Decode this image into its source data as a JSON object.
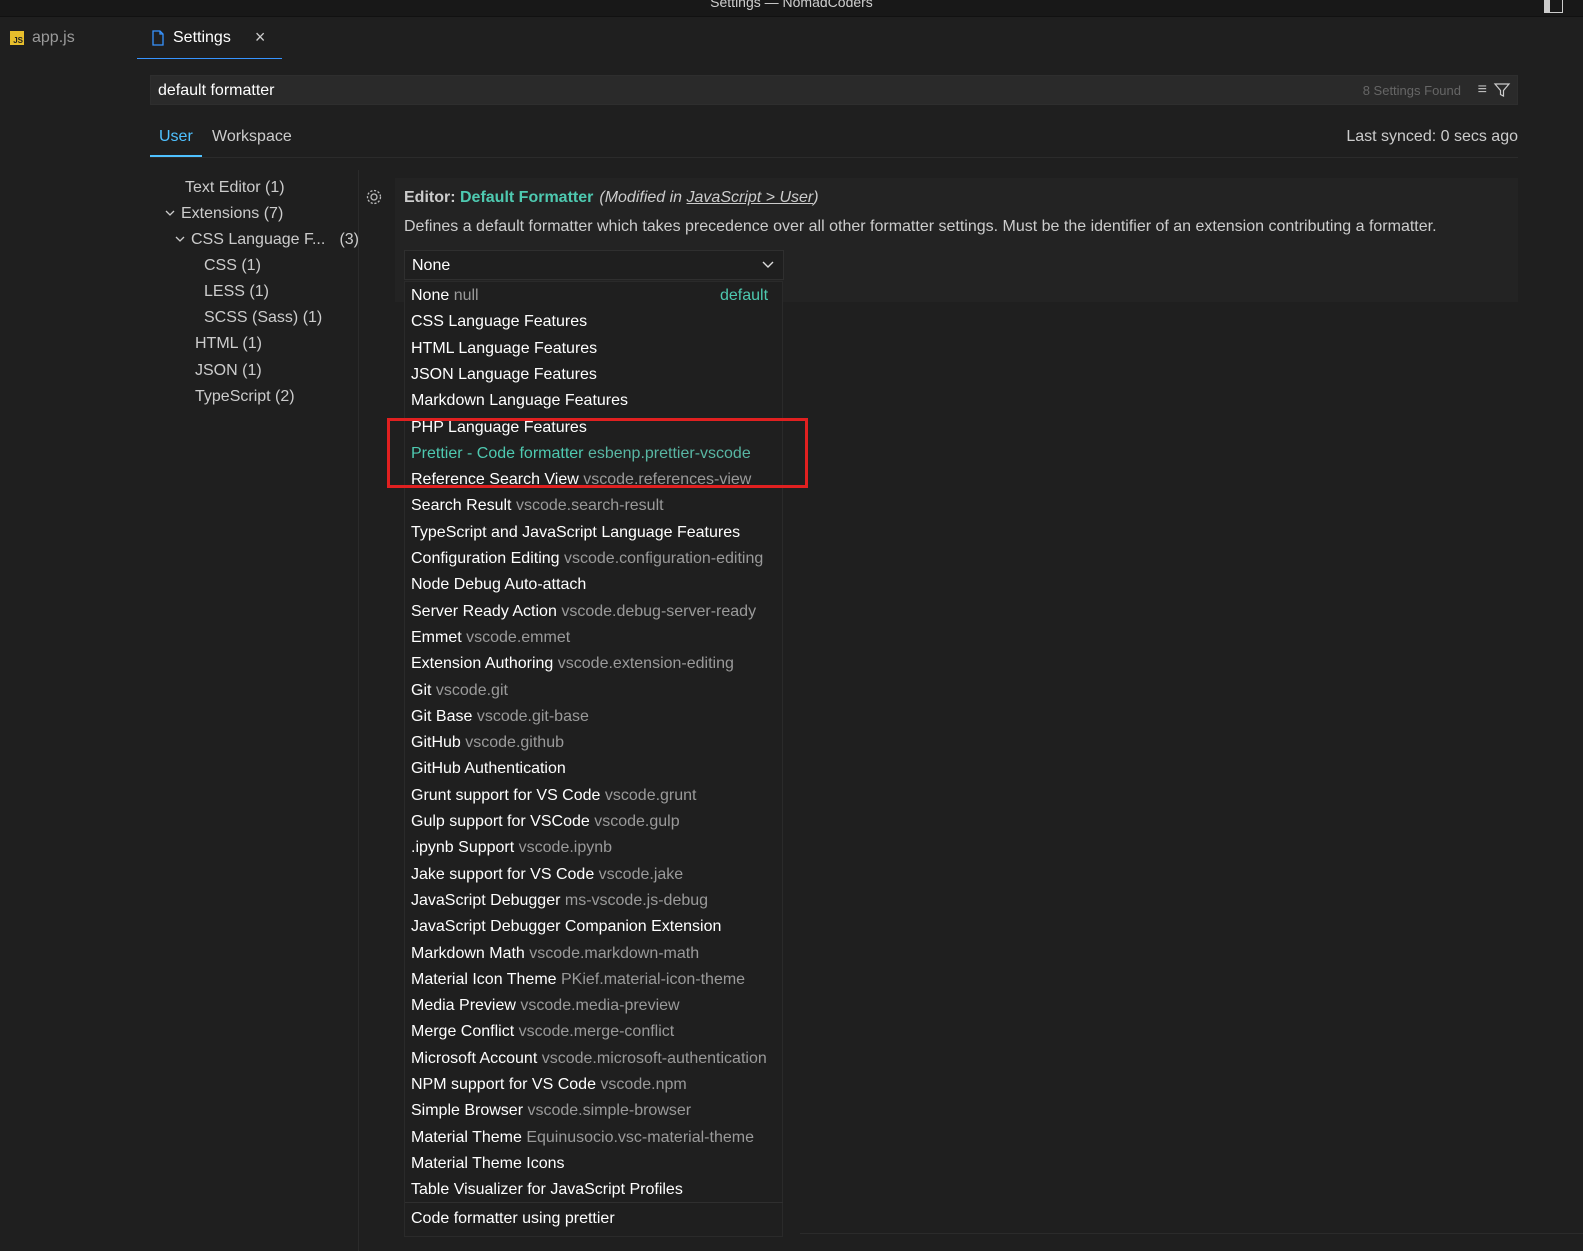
{
  "window": {
    "title": "Settings — NomadCoders"
  },
  "tabs": {
    "app": {
      "icon": "javascript-file-icon",
      "label": "app.js"
    },
    "settings": {
      "icon": "file-icon",
      "label": "Settings",
      "close": "×"
    }
  },
  "search": {
    "query": "default formatter",
    "results_found": "8 Settings Found",
    "clear_icon": "clear-filter-icon",
    "filter_icon": "filter-icon"
  },
  "scope": {
    "user": "User",
    "workspace": "Workspace",
    "last_synced": "Last synced: 0 secs ago"
  },
  "toc": [
    {
      "label": "Text Editor (1)"
    },
    {
      "label": "Extensions (7)",
      "expanded": true
    },
    {
      "label": "CSS Language F...",
      "count": "(3)",
      "expanded": true
    },
    {
      "label": "CSS (1)"
    },
    {
      "label": "LESS (1)"
    },
    {
      "label": "SCSS (Sass) (1)"
    },
    {
      "label": "HTML (1)"
    },
    {
      "label": "JSON (1)"
    },
    {
      "label": "TypeScript (2)"
    }
  ],
  "setting": {
    "category": "Editor: ",
    "name": "Default Formatter",
    "modified_prefix": "(Modified in ",
    "modified_link": "JavaScript > User",
    "modified_suffix": ")",
    "description": "Defines a default formatter which takes precedence over all other formatter settings. Must be the identifier of an extension contributing a formatter.",
    "selected_value": "None"
  },
  "dropdown": {
    "options": [
      {
        "label": "None",
        "id": "null",
        "badge": "default"
      },
      {
        "label": "CSS Language Features",
        "id": ""
      },
      {
        "label": "HTML Language Features",
        "id": ""
      },
      {
        "label": "JSON Language Features",
        "id": ""
      },
      {
        "label": "Markdown Language Features",
        "id": ""
      },
      {
        "label": "PHP Language Features",
        "id": ""
      },
      {
        "label": "Prettier - Code formatter",
        "id": "esbenp.prettier-vscode",
        "focused": true
      },
      {
        "label": "Reference Search View",
        "id": "vscode.references-view"
      },
      {
        "label": "Search Result",
        "id": "vscode.search-result"
      },
      {
        "label": "TypeScript and JavaScript Language Features",
        "id": ""
      },
      {
        "label": "Configuration Editing",
        "id": "vscode.configuration-editing"
      },
      {
        "label": "Node Debug Auto-attach",
        "id": ""
      },
      {
        "label": "Server Ready Action",
        "id": "vscode.debug-server-ready"
      },
      {
        "label": "Emmet",
        "id": "vscode.emmet"
      },
      {
        "label": "Extension Authoring",
        "id": "vscode.extension-editing"
      },
      {
        "label": "Git",
        "id": "vscode.git"
      },
      {
        "label": "Git Base",
        "id": "vscode.git-base"
      },
      {
        "label": "GitHub",
        "id": "vscode.github"
      },
      {
        "label": "GitHub Authentication",
        "id": ""
      },
      {
        "label": "Grunt support for VS Code",
        "id": "vscode.grunt"
      },
      {
        "label": "Gulp support for VSCode",
        "id": "vscode.gulp"
      },
      {
        "label": ".ipynb Support",
        "id": "vscode.ipynb"
      },
      {
        "label": "Jake support for VS Code",
        "id": "vscode.jake"
      },
      {
        "label": "JavaScript Debugger",
        "id": "ms-vscode.js-debug"
      },
      {
        "label": "JavaScript Debugger Companion Extension",
        "id": ""
      },
      {
        "label": "Markdown Math",
        "id": "vscode.markdown-math"
      },
      {
        "label": "Material Icon Theme",
        "id": "PKief.material-icon-theme"
      },
      {
        "label": "Media Preview",
        "id": "vscode.media-preview"
      },
      {
        "label": "Merge Conflict",
        "id": "vscode.merge-conflict"
      },
      {
        "label": "Microsoft Account",
        "id": "vscode.microsoft-authentication"
      },
      {
        "label": "NPM support for VS Code",
        "id": "vscode.npm"
      },
      {
        "label": "Simple Browser",
        "id": "vscode.simple-browser"
      },
      {
        "label": "Material Theme",
        "id": "Equinusocio.vsc-material-theme"
      },
      {
        "label": "Material Theme Icons",
        "id": ""
      },
      {
        "label": "Table Visualizer for JavaScript Profiles",
        "id": ""
      }
    ],
    "footer_description": "Code formatter using prettier"
  },
  "colors": {
    "accent": "#4fc1ff",
    "focused_option": "#4ec9b0",
    "annotation": "#e02020"
  }
}
